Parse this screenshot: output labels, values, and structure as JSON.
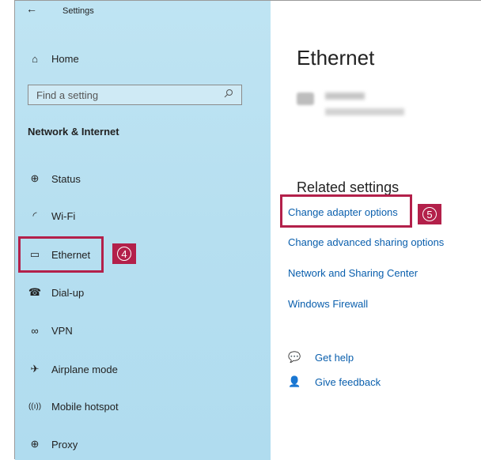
{
  "window": {
    "title": "Settings",
    "back_icon": "←"
  },
  "sidebar": {
    "home": {
      "icon": "⌂",
      "label": "Home"
    },
    "search": {
      "placeholder": "Find a setting"
    },
    "section_title": "Network & Internet",
    "items": [
      {
        "icon": "⊕",
        "label": "Status"
      },
      {
        "icon": "◜",
        "label": "Wi-Fi"
      },
      {
        "icon": "▭",
        "label": "Ethernet",
        "selected": true
      },
      {
        "icon": "☎",
        "label": "Dial-up"
      },
      {
        "icon": "∞",
        "label": "VPN"
      },
      {
        "icon": "✈",
        "label": "Airplane mode"
      },
      {
        "icon": "((ı))",
        "label": "Mobile hotspot"
      },
      {
        "icon": "⊕",
        "label": "Proxy"
      }
    ],
    "callout_number": "4"
  },
  "main": {
    "title": "Ethernet",
    "related_title": "Related settings",
    "links": [
      "Change adapter options",
      "Change advanced sharing options",
      "Network and Sharing Center",
      "Windows Firewall"
    ],
    "callout_number": "5",
    "help": [
      {
        "icon": "💬",
        "label": "Get help"
      },
      {
        "icon": "👤",
        "label": "Give feedback"
      }
    ]
  },
  "colors": {
    "accent": "#b3204a",
    "link": "#0a5fad",
    "sidebar": "#b6dff0"
  }
}
